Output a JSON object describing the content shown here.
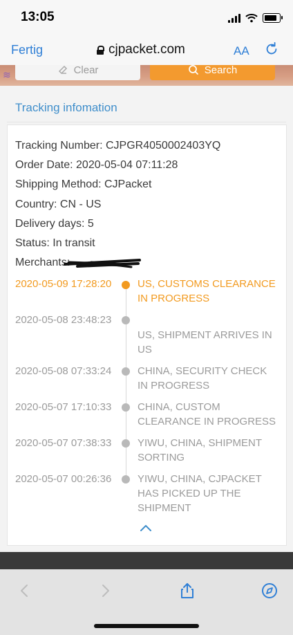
{
  "status": {
    "time": "13:05"
  },
  "browser": {
    "done_label": "Fertig",
    "url": "cjpacket.com",
    "aa_label": "AA"
  },
  "toolbar": {
    "clear_label": "Clear",
    "search_label": "Search"
  },
  "section": {
    "title": "Tracking infomation"
  },
  "details": [
    {
      "label": "Tracking Number",
      "value": "CJPGR4050002403YQ"
    },
    {
      "label": "Order Date",
      "value": "2020-05-04 07:11:28"
    },
    {
      "label": "Shipping Method",
      "value": "CJPacket"
    },
    {
      "label": "Country",
      "value": "CN - US"
    },
    {
      "label": "Delivery days",
      "value": "5"
    },
    {
      "label": "Status",
      "value": "In transit"
    },
    {
      "label": "Merchants",
      "value": ""
    }
  ],
  "detail_lines": [
    "Tracking Number: CJPGR4050002403YQ",
    "Order Date: 2020-05-04 07:11:28",
    "Shipping Method: CJPacket",
    "Country: CN - US",
    "Delivery days: 5",
    "Status: In transit",
    "Merchants:"
  ],
  "events": [
    {
      "date": "2020-05-09 17:28:20",
      "desc": "US, CUSTOMS CLEARANCE IN PROGRESS"
    },
    {
      "date": "2020-05-08 23:48:23",
      "desc": "US, SHIPMENT ARRIVES IN US"
    },
    {
      "date": "2020-05-08 07:33:24",
      "desc": "CHINA, SECURITY CHECK IN PROGRESS"
    },
    {
      "date": "2020-05-07 17:10:33",
      "desc": "CHINA, CUSTOM CLEARANCE IN PROGRESS"
    },
    {
      "date": "2020-05-07 07:38:33",
      "desc": "YIWU, CHINA, SHIPMENT SORTING"
    },
    {
      "date": "2020-05-07 00:26:36",
      "desc": "YIWU, CHINA, CJPACKET HAS PICKED UP THE SHIPMENT"
    }
  ],
  "colors": {
    "accent": "#f29a1f",
    "link": "#3f8ecb",
    "browser_blue": "#2f7fd6"
  },
  "icons": {
    "clear": "clear-icon",
    "search": "search-icon",
    "lock": "lock-icon",
    "reload": "reload-icon",
    "back": "back-icon",
    "forward": "forward-icon",
    "share": "share-icon",
    "compass": "compass-icon",
    "collapse": "chevron-up-icon"
  }
}
